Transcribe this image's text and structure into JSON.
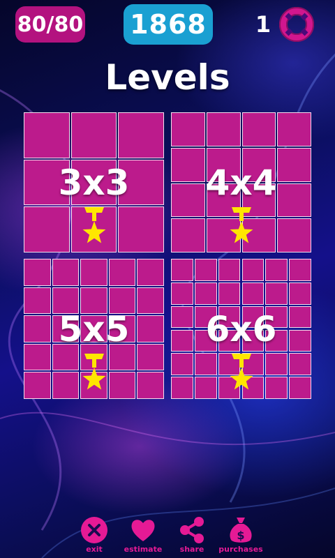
{
  "header": {
    "progress": "80/80",
    "score": "1868",
    "hints": "1"
  },
  "title": "Levels",
  "levels": [
    {
      "label": "3x3",
      "size": 3,
      "medal": "star-medal"
    },
    {
      "label": "4x4",
      "size": 4,
      "medal": "star-medal"
    },
    {
      "label": "5x5",
      "size": 5,
      "medal": "star-medal"
    },
    {
      "label": "6x6",
      "size": 6,
      "medal": "star-medal"
    }
  ],
  "bottom_bar": {
    "exit": "exit",
    "estimate": "estimate",
    "share": "share",
    "purchases": "purchases"
  },
  "colors": {
    "tile": "#bc1b8c",
    "progress_badge": "#b3127f",
    "score_badge": "#1aa0d2",
    "accent": "#e51a95",
    "medal": "#ffe600"
  },
  "icons": [
    "lifebuoy-icon",
    "star-medal-icon",
    "close-icon",
    "heart-icon",
    "share-icon",
    "money-bag-icon"
  ]
}
